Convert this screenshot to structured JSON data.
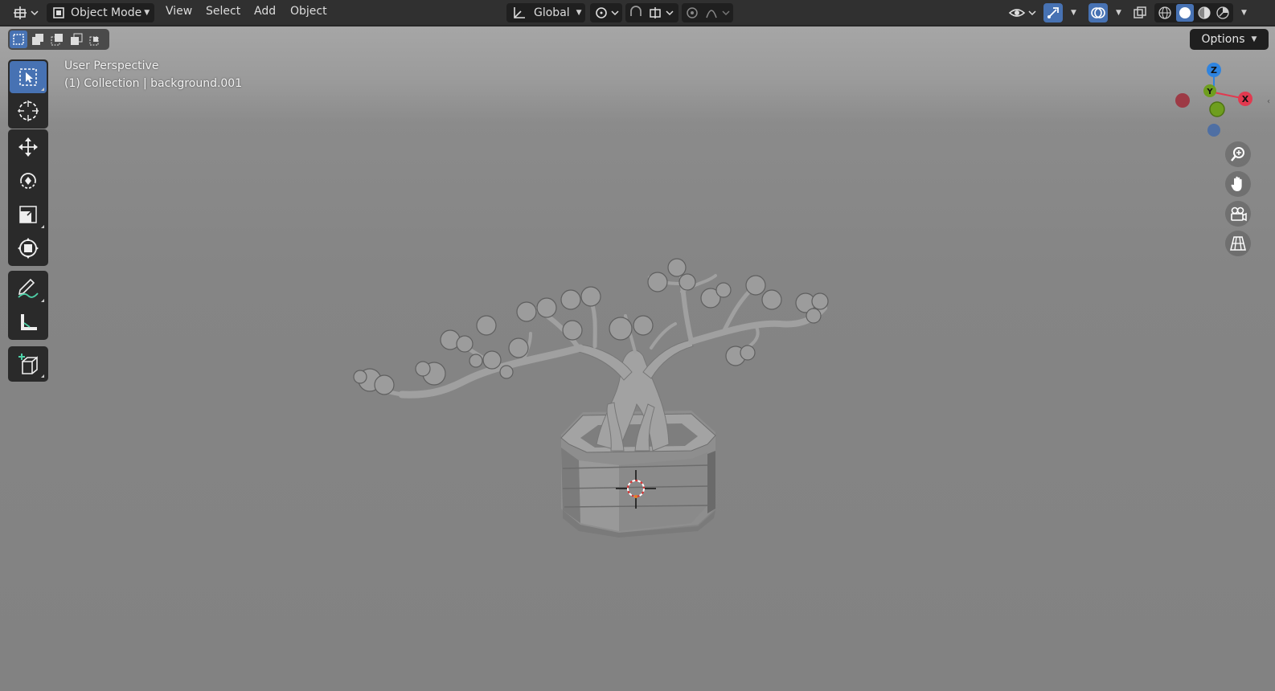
{
  "header": {
    "mode_label": "Object Mode",
    "menus": [
      "View",
      "Select",
      "Add",
      "Object"
    ],
    "transform_orientation": "Global"
  },
  "viewport": {
    "perspective_label": "User Perspective",
    "collection_label": "(1) Collection | background.001",
    "options_label": "Options"
  },
  "gizmo": {
    "axes": [
      "Z",
      "Y",
      "X"
    ],
    "colors": {
      "x": "#e2394f",
      "y": "#6e9e1e",
      "z": "#2f84e0"
    }
  },
  "toolbar": {
    "tools": [
      "select-box",
      "cursor",
      "move",
      "rotate",
      "scale",
      "transform",
      "annotate",
      "measure",
      "add-cube"
    ]
  },
  "colors": {
    "accent": "#4772b3",
    "header_bg": "#303030"
  }
}
